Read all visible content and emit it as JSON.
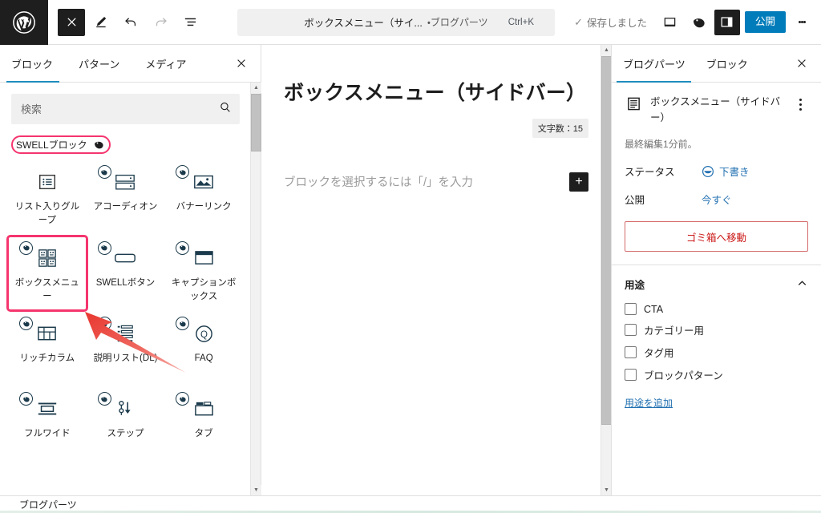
{
  "topbar": {
    "wp_logo": "wordpress-logo",
    "close_label": "×",
    "tools": [
      {
        "name": "close-editor-button",
        "icon": "close-icon"
      },
      {
        "name": "edit-mode-button",
        "icon": "pencil-icon"
      },
      {
        "name": "undo-button",
        "icon": "undo-icon"
      },
      {
        "name": "redo-button",
        "icon": "redo-icon"
      },
      {
        "name": "list-view-button",
        "icon": "list-view-icon"
      }
    ],
    "command_bar": {
      "title": "ボックスメニュー（サイ...",
      "subtitle": "・ブログパーツ",
      "shortcut": "Ctrl+K"
    },
    "saved_text": "保存しました",
    "saved_check": "✓",
    "view_icon": "desktop-icon",
    "swell_icon": "swell-bird-icon",
    "settings_icon": "sidebar-toggle-icon",
    "publish_label": "公開",
    "more_icon": "kebab-menu-icon"
  },
  "inserter": {
    "tabs": [
      {
        "label": "ブロック",
        "active": true
      },
      {
        "label": "パターン",
        "active": false
      },
      {
        "label": "メディア",
        "active": false
      }
    ],
    "close_icon": "close-icon",
    "search": {
      "value": "",
      "placeholder": "検索",
      "icon": "search-icon"
    },
    "category": {
      "label": "SWELLブロック",
      "icon": "swell-bird-icon",
      "highlight_color": "#f5356e"
    },
    "blocks": [
      {
        "label": "リスト入りグループ",
        "icon": "list-group-icon",
        "badge": false,
        "highlighted": false
      },
      {
        "label": "アコーディオン",
        "icon": "accordion-icon",
        "badge": true,
        "highlighted": false
      },
      {
        "label": "バナーリンク",
        "icon": "banner-link-icon",
        "badge": true,
        "highlighted": false
      },
      {
        "label": "ボックスメニュー",
        "icon": "box-menu-icon",
        "badge": true,
        "highlighted": true
      },
      {
        "label": "SWELLボタン",
        "icon": "swell-button-icon",
        "badge": true,
        "highlighted": false
      },
      {
        "label": "キャプションボックス",
        "icon": "caption-box-icon",
        "badge": true,
        "highlighted": false
      },
      {
        "label": "リッチカラム",
        "icon": "rich-column-icon",
        "badge": true,
        "highlighted": false
      },
      {
        "label": "説明リスト(DL)",
        "icon": "description-list-icon",
        "badge": true,
        "highlighted": false
      },
      {
        "label": "FAQ",
        "icon": "faq-icon",
        "badge": true,
        "highlighted": false
      },
      {
        "label": "フルワイド",
        "icon": "full-wide-icon",
        "badge": true,
        "highlighted": false
      },
      {
        "label": "ステップ",
        "icon": "step-icon",
        "badge": true,
        "highlighted": false
      },
      {
        "label": "タブ",
        "icon": "tab-icon",
        "badge": true,
        "highlighted": false
      }
    ]
  },
  "editor": {
    "title": "ボックスメニュー（サイドバー）",
    "char_count_label": "文字数：15",
    "placeholder": "ブロックを選択するには「/」を入力",
    "add_block_label": "+"
  },
  "sidebar": {
    "tabs": [
      {
        "label": "ブログパーツ",
        "active": true
      },
      {
        "label": "ブロック",
        "active": false
      }
    ],
    "close_icon": "close-icon",
    "document": {
      "icon": "document-icon",
      "name": "ボックスメニュー（サイドバー）",
      "more_icon": "kebab-menu-icon",
      "last_edited": "最終編集1分前。"
    },
    "status": {
      "key": "ステータス",
      "value": "下書き",
      "icon": "draft-status-icon"
    },
    "publish": {
      "key": "公開",
      "value": "今すぐ"
    },
    "trash_label": "ゴミ箱へ移動",
    "usage_panel": {
      "title": "用途",
      "chevron": "chevron-up-icon",
      "items": [
        {
          "label": "CTA",
          "checked": false
        },
        {
          "label": "カテゴリー用",
          "checked": false
        },
        {
          "label": "タグ用",
          "checked": false
        },
        {
          "label": "ブロックパターン",
          "checked": false
        }
      ],
      "add_link": "用途を追加"
    }
  },
  "bottombar": {
    "breadcrumb": "ブログパーツ"
  },
  "annotation": {
    "arrow_color": "#e03b3b",
    "box_color": "#f5356e"
  }
}
